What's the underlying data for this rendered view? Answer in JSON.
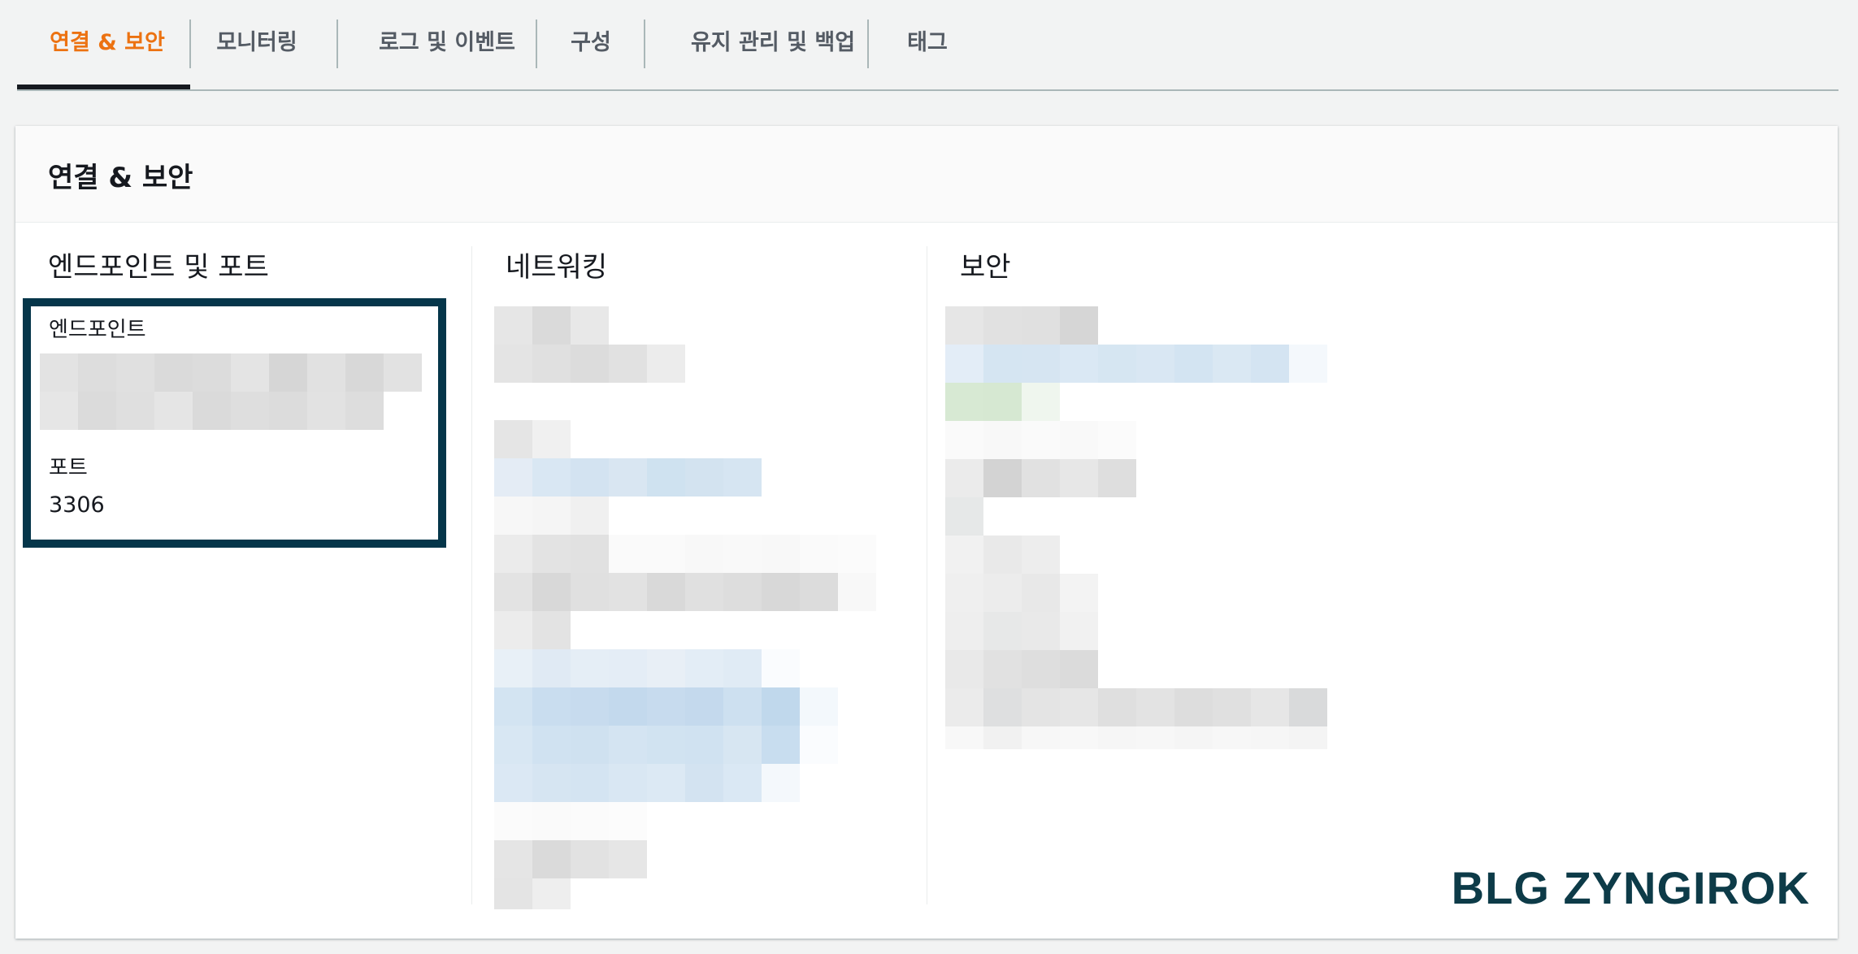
{
  "tabs": [
    {
      "label": "연결 & 보안",
      "active": true
    },
    {
      "label": "모니터링",
      "active": false
    },
    {
      "label": "로그 및 이벤트",
      "active": false
    },
    {
      "label": "구성",
      "active": false
    },
    {
      "label": "유지 관리 및 백업",
      "active": false
    },
    {
      "label": "태그",
      "active": false
    }
  ],
  "panel": {
    "title": "연결 & 보안",
    "columns": {
      "endpoints": {
        "title": "엔드포인트 및 포트",
        "endpoint_label": "엔드포인트",
        "port_label": "포트",
        "port_value": "3306"
      },
      "networking": {
        "title": "네트워킹"
      },
      "security": {
        "title": "보안"
      }
    }
  },
  "watermark": "BLG ZYNGIROK",
  "colors": {
    "accent": "#ec7211",
    "highlight_border": "#05364a",
    "text": "#16191f"
  }
}
